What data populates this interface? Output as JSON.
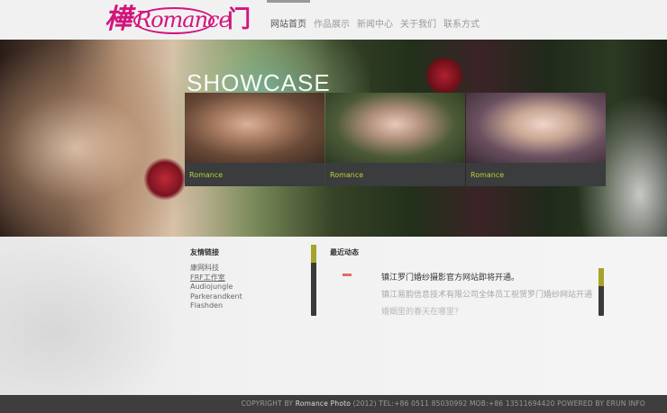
{
  "header": {
    "logo": {
      "han_left": "樺",
      "script": "Romance",
      "han_right": "门"
    },
    "nav": [
      {
        "label": "网站首页",
        "active": true
      },
      {
        "label": "作品展示",
        "active": false
      },
      {
        "label": "新闻中心",
        "active": false
      },
      {
        "label": "关于我们",
        "active": false
      },
      {
        "label": "联系方式",
        "active": false
      }
    ]
  },
  "banner": {
    "title": "SHOWCASE",
    "items": [
      {
        "caption": "Romance"
      },
      {
        "caption": "Romance"
      },
      {
        "caption": "Romance"
      }
    ]
  },
  "links_section": {
    "title": "友情链接",
    "items": [
      "康网科技",
      "FRF工作室",
      "Audiojungle",
      "Parkerandkent",
      "Flashden"
    ]
  },
  "news_section": {
    "title": "最近动态",
    "items": [
      "镇江罗门婚纱摄影官方网站即将开通。",
      "镇江易韵信息技术有限公司全体员工祝贺罗门婚纱网站开通",
      "婚姻里的春天在哪里？"
    ]
  },
  "footer": {
    "prefix": "COPYRIGHT BY ",
    "brand": "Romance Photo",
    "suffix": " (2012)   TEL:+86 0511 85030992   MOB:+86 13511694420 POWERED BY ERUN INFO"
  },
  "colors": {
    "accent": "#d2157e",
    "caption_text": "#b8d23a",
    "scroll_thumb": "#a7a32a",
    "footer_bg": "#3e3e3e"
  }
}
